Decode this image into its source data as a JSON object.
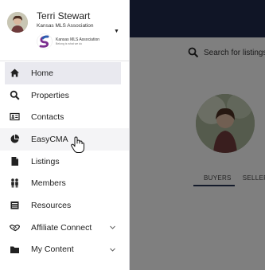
{
  "user": {
    "name": "Terri Stewart",
    "organization": "Kansas MLS Association",
    "org_logo_name": "Kansas MLS Association",
    "org_logo_tagline": "Belong is what we do"
  },
  "nav": {
    "items": [
      {
        "label": "Home",
        "icon": "home-icon",
        "active": true
      },
      {
        "label": "Properties",
        "icon": "search-icon"
      },
      {
        "label": "Contacts",
        "icon": "contact-card-icon"
      },
      {
        "label": "EasyCMA",
        "icon": "pie-chart-icon",
        "hover": true
      },
      {
        "label": "Listings",
        "icon": "document-icon"
      },
      {
        "label": "Members",
        "icon": "members-icon"
      },
      {
        "label": "Resources",
        "icon": "resources-icon"
      },
      {
        "label": "Affiliate Connect",
        "icon": "handshake-icon",
        "expandable": true
      },
      {
        "label": "My Content",
        "icon": "folder-icon",
        "expandable": true
      }
    ]
  },
  "background": {
    "search_placeholder": "Search for listings",
    "tabs": [
      "BUYERS",
      "SELLERS"
    ]
  },
  "colors": {
    "topbar": "#1f2a4a",
    "active_item_bg": "#e9e9ef",
    "brand_purple": "#7b2d8e",
    "brand_blue": "#2a5db0"
  }
}
